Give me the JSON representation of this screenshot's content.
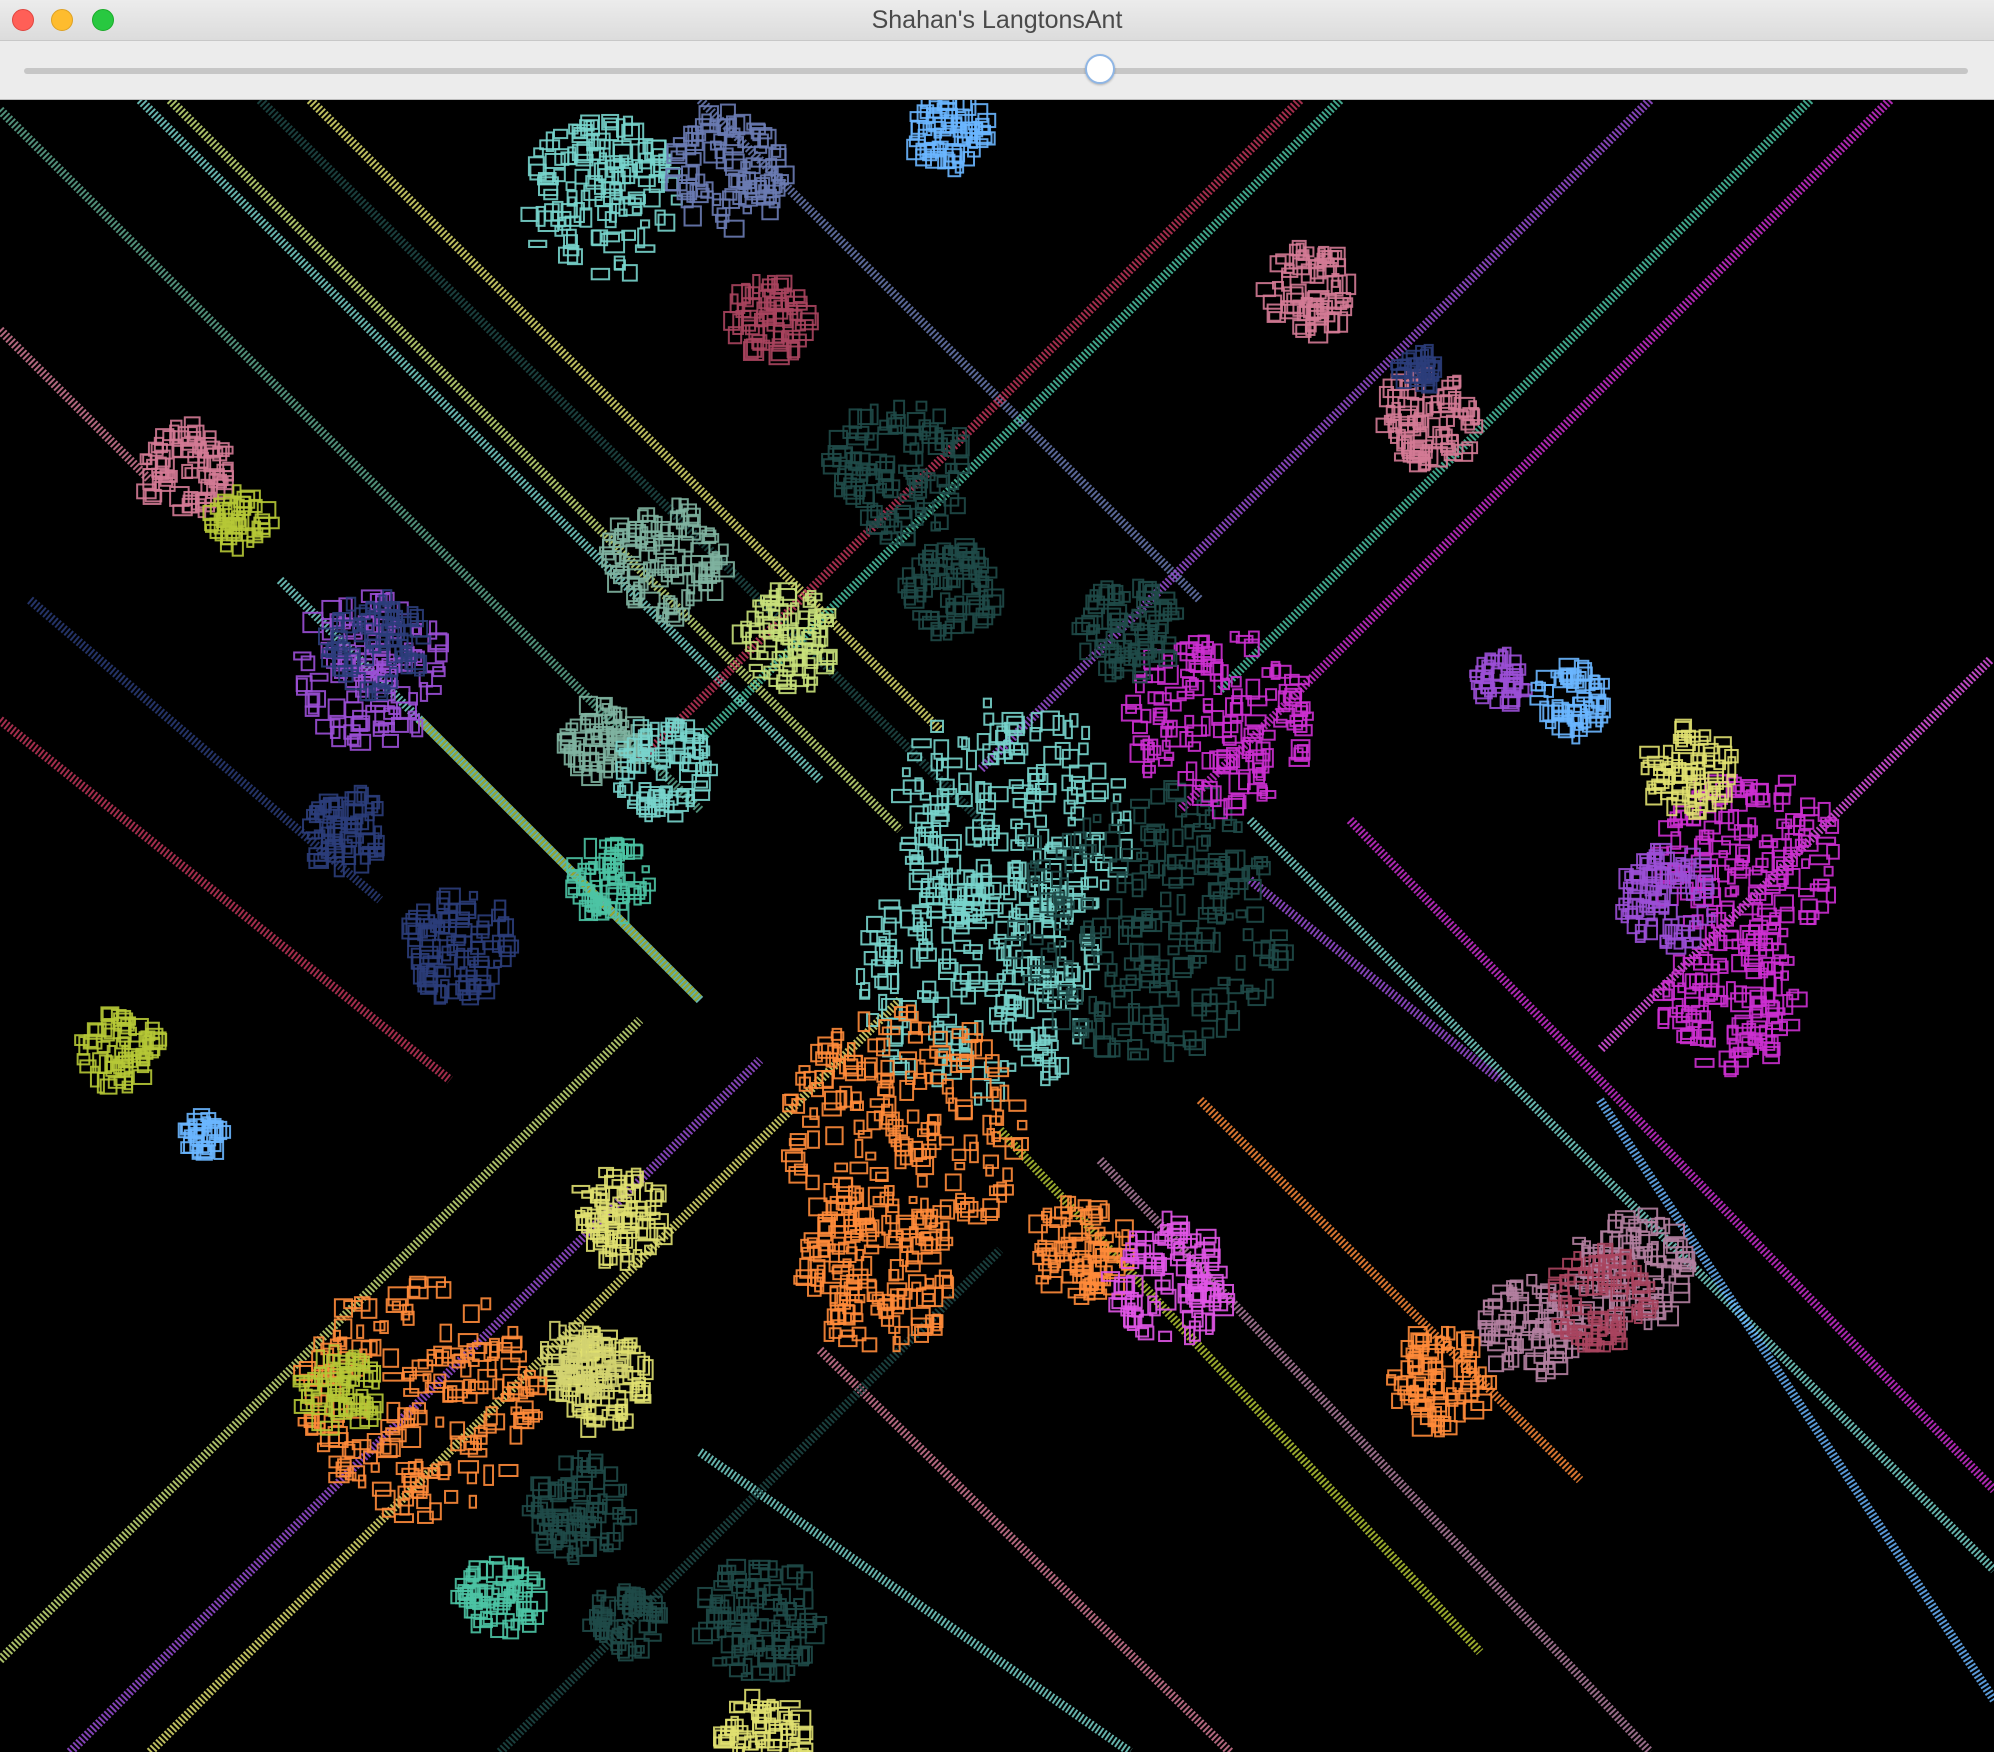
{
  "window": {
    "title": "Shahan's LangtonsAnt"
  },
  "controls": {
    "speed_slider_level": 0.55
  },
  "simulation": {
    "background": "#000000",
    "palette": [
      "#5fa88f",
      "#78d4cc",
      "#c8e07a",
      "#c0365a",
      "#9b4fd6",
      "#e055e6",
      "#2b3d7a",
      "#d37a95",
      "#4cc4a4",
      "#1f4a48",
      "#cc2fd0",
      "#e0e070",
      "#ff8b3a",
      "#b6c836",
      "#6ab6ff",
      "#6a7bb3",
      "#a8445e",
      "#7fb2a0",
      "#d3d370",
      "#b37fa0"
    ]
  }
}
